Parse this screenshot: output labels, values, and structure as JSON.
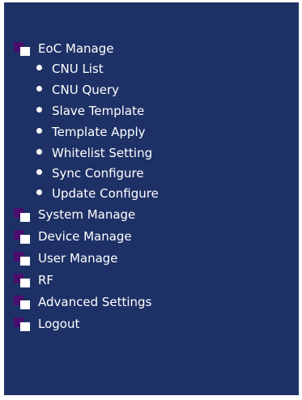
{
  "menu": {
    "eoc_manage": {
      "label": "EoC Manage",
      "items": [
        {
          "label": "CNU List"
        },
        {
          "label": "CNU Query"
        },
        {
          "label": "Slave Template"
        },
        {
          "label": "Template Apply"
        },
        {
          "label": "Whitelist Setting"
        },
        {
          "label": "Sync Configure"
        },
        {
          "label": "Update Configure"
        }
      ]
    },
    "sections": [
      {
        "label": "System Manage"
      },
      {
        "label": "Device Manage"
      },
      {
        "label": "User Manage"
      },
      {
        "label": "RF"
      },
      {
        "label": "Advanced Settings"
      },
      {
        "label": "Logout"
      }
    ]
  },
  "colors": {
    "panel_bg": "#1e3166",
    "folder_back": "#4a0d6e",
    "text": "#ffffff"
  },
  "icons": {
    "section": "folder-icon",
    "item": "bullet-icon"
  }
}
